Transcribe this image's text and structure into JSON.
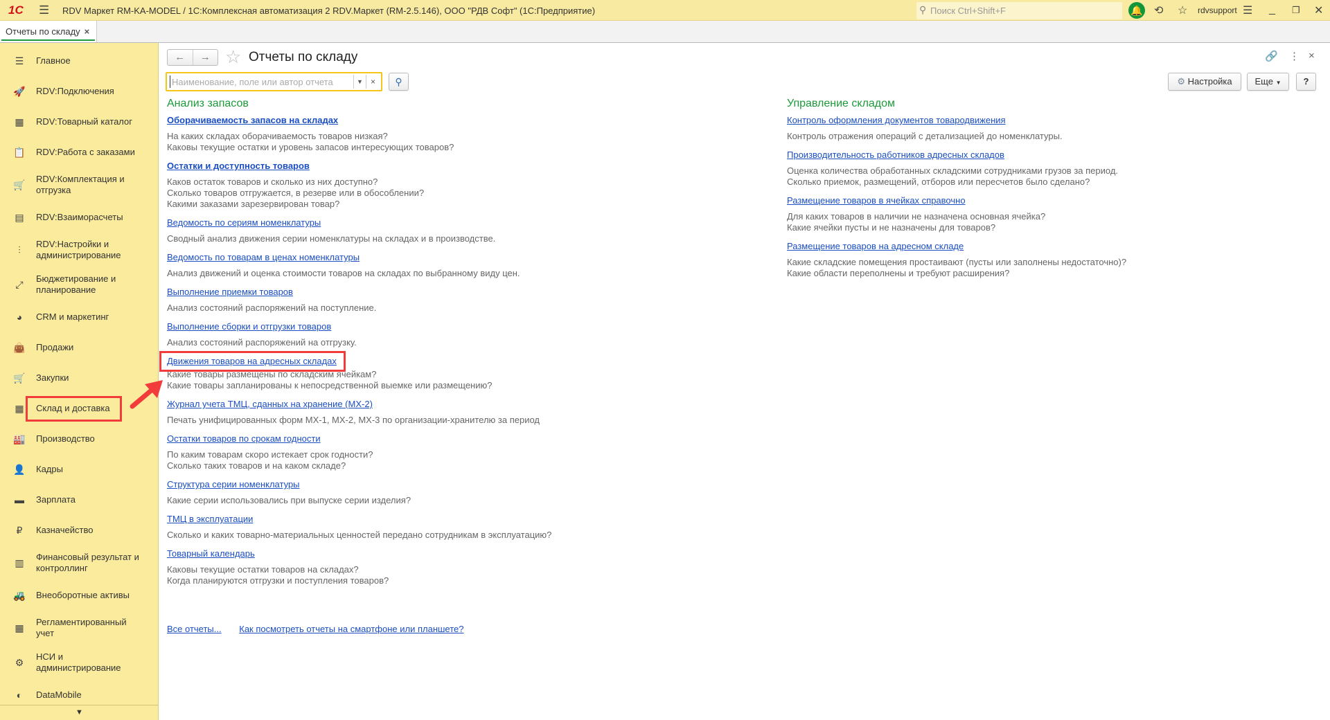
{
  "titlebar": {
    "logo": "1С",
    "title": "RDV Маркет RM-KA-MODEL / 1С:Комплексная автоматизация 2 RDV.Маркет (RM-2.5.146), ООО \"РДВ Софт\"  (1С:Предприятие)",
    "search_placeholder": "Поиск Ctrl+Shift+F",
    "user": "rdvsupport"
  },
  "tabs": [
    {
      "label": "Отчеты по складу",
      "close": "×"
    }
  ],
  "sidebar": {
    "items": [
      {
        "label": "Главное",
        "icon": "☰",
        "name": "menu"
      },
      {
        "label": "RDV:Подключения",
        "icon": "🚀",
        "name": "rocket"
      },
      {
        "label": "RDV:Товарный каталог",
        "icon": "▦",
        "name": "catalog"
      },
      {
        "label": "RDV:Работа с заказами",
        "icon": "📋",
        "name": "orders"
      },
      {
        "label": "RDV:Комплектация и отгрузка",
        "icon": "🛒",
        "name": "hand-truck"
      },
      {
        "label": "RDV:Взаиморасчеты",
        "icon": "▤",
        "name": "calculator"
      },
      {
        "label": "RDV:Настройки и администрирование",
        "icon": "⫶",
        "name": "sliders"
      },
      {
        "label": "Бюджетирование и планирование",
        "icon": "⤢",
        "name": "budget-chart"
      },
      {
        "label": "CRM и маркетинг",
        "icon": "◕",
        "name": "pie-chart"
      },
      {
        "label": "Продажи",
        "icon": "👜",
        "name": "shopping-bag"
      },
      {
        "label": "Закупки",
        "icon": "🛒",
        "name": "cart"
      },
      {
        "label": "Склад и доставка",
        "icon": "▦",
        "name": "warehouse"
      },
      {
        "label": "Производство",
        "icon": "🏭",
        "name": "factory"
      },
      {
        "label": "Кадры",
        "icon": "👤",
        "name": "person"
      },
      {
        "label": "Зарплата",
        "icon": "▬",
        "name": "card"
      },
      {
        "label": "Казначейство",
        "icon": "₽",
        "name": "ruble-coin"
      },
      {
        "label": "Финансовый результат и контроллинг",
        "icon": "▥",
        "name": "bar-chart"
      },
      {
        "label": "Внеоборотные активы",
        "icon": "🚜",
        "name": "truck"
      },
      {
        "label": "Регламентированный учет",
        "icon": "▦",
        "name": "ledger"
      },
      {
        "label": "НСИ и администрирование",
        "icon": "⚙",
        "name": "gear"
      },
      {
        "label": "DataMobile",
        "icon": "◐",
        "name": "datamobile-logo"
      }
    ],
    "selected": "Склад и доставка"
  },
  "form": {
    "title": "Отчеты по складу",
    "search_placeholder": "Наименование, поле или автор отчета",
    "settings_label": "Настройка",
    "more_label": "Еще",
    "help_label": "?"
  },
  "sections": [
    {
      "title": "Анализ запасов",
      "reports": [
        {
          "title": "Оборачиваемость запасов на складах",
          "bold": true,
          "desc": [
            "На каких складах оборачиваемость товаров низкая?",
            "Каковы текущие остатки и уровень запасов интересующих товаров?"
          ]
        },
        {
          "title": "Остатки и доступность товаров",
          "bold": true,
          "desc": [
            "Каков остаток товаров и сколько из них доступно?",
            "Сколько товаров отгружается, в резерве или в обособлении?",
            "Какими заказами зарезервирован товар?"
          ]
        },
        {
          "title": "Ведомость по сериям номенклатуры",
          "desc": [
            "Сводный анализ движения серии номенклатуры на складах и в производстве."
          ]
        },
        {
          "title": "Ведомость по товарам в ценах номенклатуры",
          "desc": [
            "Анализ движений и оценка стоимости товаров на складах по выбранному виду цен."
          ]
        },
        {
          "title": "Выполнение приемки товаров",
          "desc": [
            "Анализ состояний распоряжений на поступление."
          ]
        },
        {
          "title": "Выполнение сборки и отгрузки товаров",
          "desc": [
            "Анализ состояний распоряжений на отгрузку."
          ]
        },
        {
          "title": "Движения товаров на адресных складах",
          "highlighted": true,
          "desc": [
            "Какие товары размещены по складским ячейкам?",
            "Какие товары запланированы к непосредственной выемке или размещению?"
          ]
        },
        {
          "title": "Журнал учета ТМЦ, сданных на хранение (МХ-2)",
          "desc": [
            "Печать унифицированных форм МХ-1, МХ-2, МХ-3 по организации-хранителю за период"
          ]
        },
        {
          "title": "Остатки товаров по срокам годности",
          "desc": [
            "По каким товарам скоро истекает срок годности?",
            "Сколько таких товаров и на каком складе?"
          ]
        },
        {
          "title": "Структура серии номенклатуры",
          "desc": [
            "Какие серии использовались при выпуске серии изделия?"
          ]
        },
        {
          "title": "ТМЦ в эксплуатации",
          "desc": [
            "Сколько и каких товарно-материальных ценностей передано сотрудникам в эксплуатацию?"
          ]
        },
        {
          "title": "Товарный календарь",
          "desc": [
            "Каковы текущие остатки товаров на складах?",
            "Когда планируются отгрузки и поступления товаров?"
          ]
        }
      ]
    },
    {
      "title": "Управление складом",
      "reports": [
        {
          "title": "Контроль оформления документов товародвижения",
          "desc": [
            "Контроль отражения операций с детализацией до номенклатуры."
          ]
        },
        {
          "title": "Производительность работников адресных складов",
          "desc": [
            "Оценка количества обработанных складскими сотрудниками грузов за период.",
            "Сколько приемок, размещений, отборов или пересчетов было сделано?"
          ]
        },
        {
          "title": "Размещение товаров в ячейках справочно",
          "desc": [
            "Для каких товаров в наличии не назначена основная ячейка?",
            "Какие ячейки пусты и не назначены для товаров?"
          ]
        },
        {
          "title": "Размещение товаров на адресном складе",
          "desc": [
            "Какие складские помещения простаивают (пусты или заполнены недостаточно)?",
            "Какие области переполнены и требуют расширения?"
          ]
        }
      ]
    }
  ],
  "footer_links": [
    "Все отчеты...",
    "Как посмотреть отчеты на смартфоне или планшете?"
  ],
  "colors": {
    "accent_green": "#1c9a3a",
    "link": "#1a4ec2",
    "sidebar": "#fbeb9d",
    "highlight": "#f23c3c"
  }
}
